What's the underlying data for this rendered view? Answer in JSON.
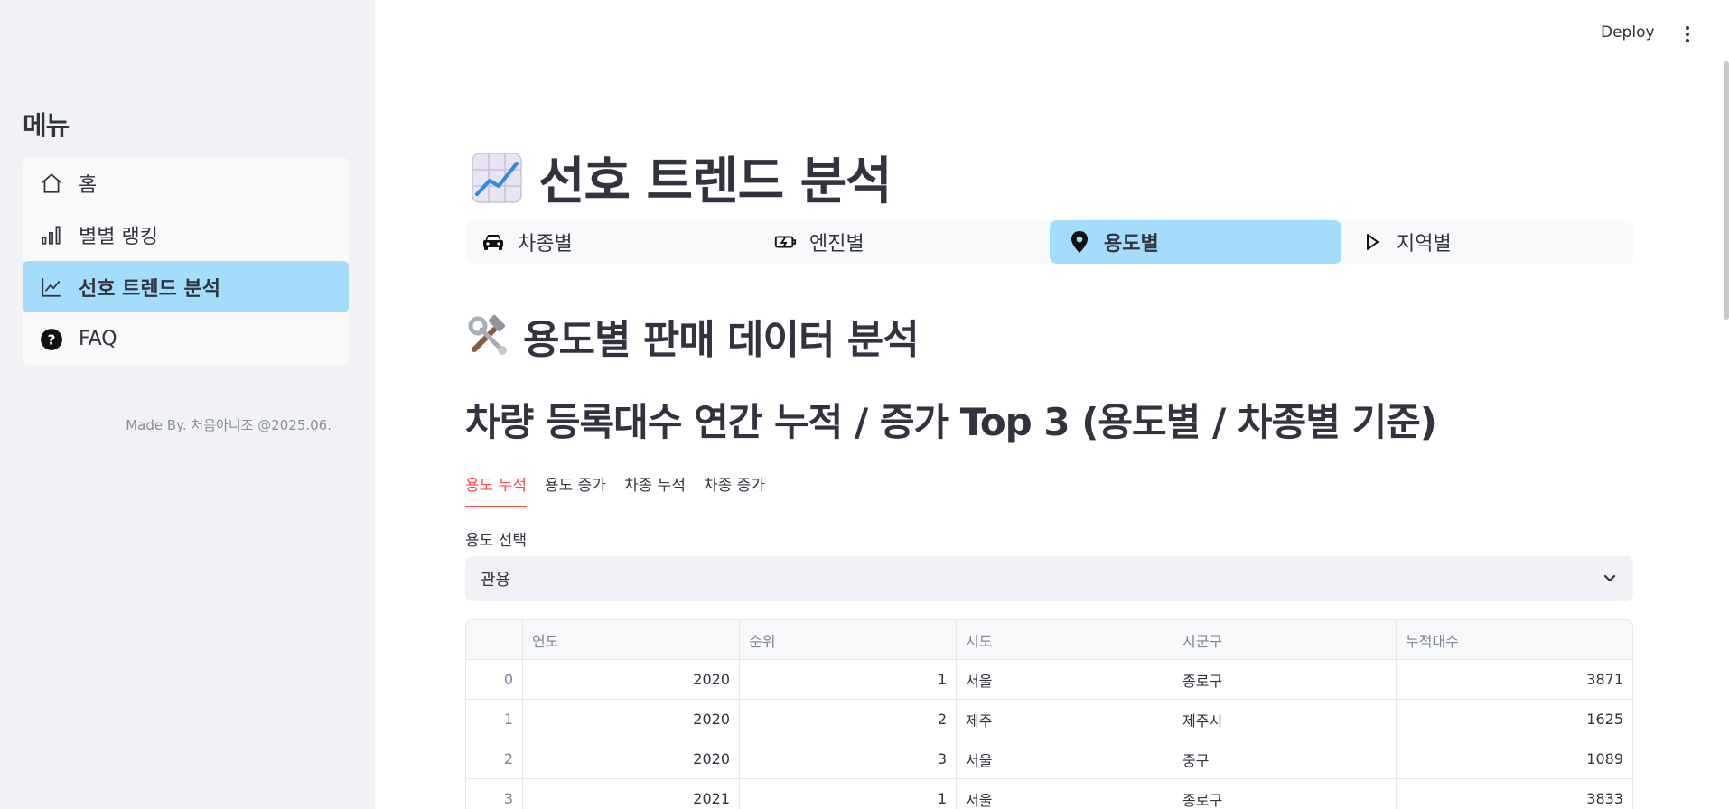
{
  "sidebar": {
    "title": "메뉴",
    "items": [
      {
        "label": "홈",
        "icon": "home-icon",
        "active": false
      },
      {
        "label": "별별 랭킹",
        "icon": "bar-chart-icon",
        "active": false
      },
      {
        "label": "선호 트렌드 분석",
        "icon": "trending-up-icon",
        "active": true
      },
      {
        "label": "FAQ",
        "icon": "help-circle-icon",
        "active": false
      }
    ],
    "footer": "Made By. 처음아니조 @2025.06."
  },
  "header": {
    "deploy_label": "Deploy",
    "menu_icon": "kebab-menu-icon"
  },
  "main": {
    "page_title": "선호 트렌드 분석",
    "page_title_icon": "chart-increasing-icon",
    "tabs": [
      {
        "label": "차종별",
        "icon": "car-icon",
        "active": false
      },
      {
        "label": "엔진별",
        "icon": "engine-icon",
        "active": false
      },
      {
        "label": "용도별",
        "icon": "map-pin-icon",
        "active": true
      },
      {
        "label": "지역별",
        "icon": "play-icon",
        "active": false
      }
    ],
    "section_title": "용도별 판매 데이터 분석",
    "section_icon": "hammer-wrench-icon",
    "subtitle": "차량 등록대수 연간 누적 / 증가 Top 3 (용도별 / 차종별 기준)",
    "subtabs": [
      {
        "label": "용도 누적",
        "active": true
      },
      {
        "label": "용도 증가",
        "active": false
      },
      {
        "label": "차종 누적",
        "active": false
      },
      {
        "label": "차종 증가",
        "active": false
      }
    ],
    "select": {
      "label": "용도 선택",
      "value": "관용"
    },
    "table": {
      "columns": [
        "",
        "연도",
        "순위",
        "시도",
        "시군구",
        "누적대수"
      ],
      "rows": [
        [
          "0",
          "2020",
          "1",
          "서울",
          "종로구",
          "3871"
        ],
        [
          "1",
          "2020",
          "2",
          "제주",
          "제주시",
          "1625"
        ],
        [
          "2",
          "2020",
          "3",
          "서울",
          "중구",
          "1089"
        ],
        [
          "3",
          "2021",
          "1",
          "서울",
          "종로구",
          "3833"
        ]
      ]
    }
  },
  "colors": {
    "accent": "#a4dcfb",
    "active_tab": "#ff4b4b",
    "sidebar_bg": "#f0f2f6"
  }
}
